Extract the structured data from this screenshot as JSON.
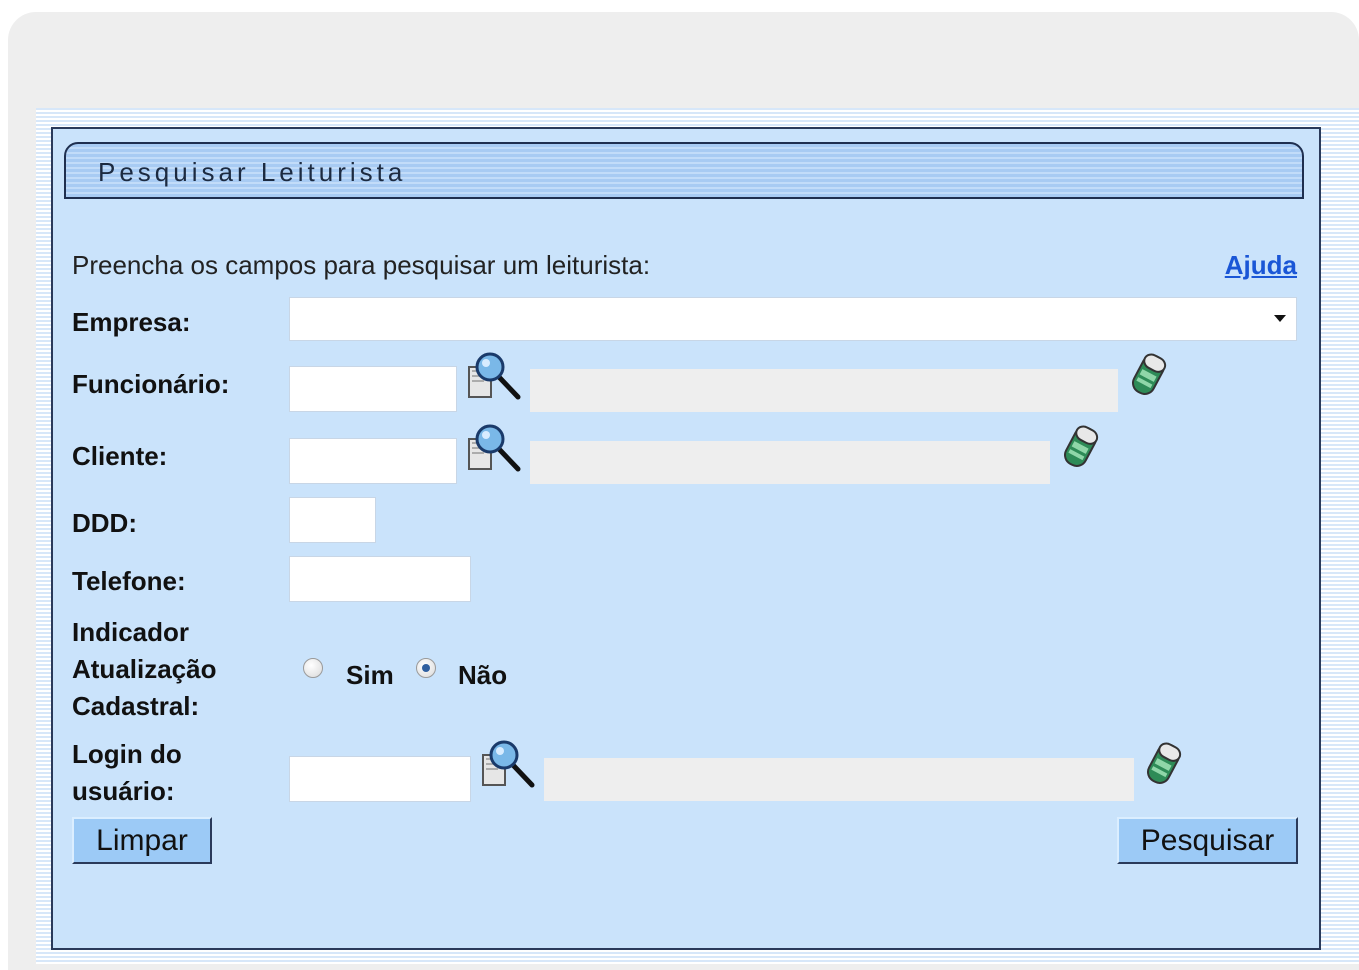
{
  "title": "Pesquisar Leiturista",
  "instructions": "Preencha os campos para pesquisar um leiturista:",
  "help_link": "Ajuda",
  "fields": {
    "empresa": {
      "label": "Empresa:",
      "value": ""
    },
    "funcionario": {
      "label": "Funcionário:",
      "code": "",
      "description": ""
    },
    "cliente": {
      "label": "Cliente:",
      "code": "",
      "description": ""
    },
    "ddd": {
      "label": "DDD:",
      "value": ""
    },
    "telefone": {
      "label": "Telefone:",
      "value": ""
    },
    "indicador": {
      "label_line1": "Indicador",
      "label_line2": "Atualização",
      "label_line3": "Cadastral:",
      "options": [
        "Sim",
        "Não"
      ],
      "selected": "Não"
    },
    "login": {
      "label_line1": "Login do",
      "label_line2": "usuário:",
      "code": "",
      "description": ""
    }
  },
  "buttons": {
    "clear": "Limpar",
    "search": "Pesquisar"
  },
  "icons": {
    "search": "magnifier-search-icon",
    "clear": "eraser-icon"
  }
}
